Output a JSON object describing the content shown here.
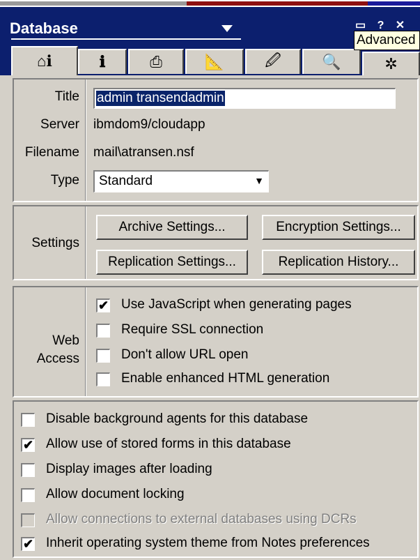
{
  "window": {
    "title": "Database",
    "tooltip": "Advanced",
    "control_icons": "▭ ? ✕"
  },
  "tabs": [
    {
      "name": "basics",
      "icon": "⌂ℹ",
      "active": true
    },
    {
      "name": "info",
      "icon": "ℹ"
    },
    {
      "name": "print",
      "icon": "⎙"
    },
    {
      "name": "design",
      "icon": "📐"
    },
    {
      "name": "launch",
      "icon": "🖉"
    },
    {
      "name": "full-text",
      "icon": "🔍"
    },
    {
      "name": "advanced",
      "icon": "✲"
    }
  ],
  "basics": {
    "title_label": "Title",
    "title_value": "admin transendadmin",
    "server_label": "Server",
    "server_value": "ibmdom9/cloudapp",
    "filename_label": "Filename",
    "filename_value": "mail\\atransen.nsf",
    "type_label": "Type",
    "type_value": "Standard"
  },
  "settings": {
    "label": "Settings",
    "archive": "Archive Settings...",
    "encryption": "Encryption Settings...",
    "replication": "Replication Settings...",
    "history": "Replication History..."
  },
  "web_access": {
    "label_line1": "Web",
    "label_line2": "Access",
    "items": [
      {
        "label": "Use JavaScript when generating pages",
        "checked": true
      },
      {
        "label": "Require SSL connection",
        "checked": false
      },
      {
        "label": "Don't allow URL open",
        "checked": false
      },
      {
        "label": "Enable enhanced HTML generation",
        "checked": false
      }
    ]
  },
  "options": [
    {
      "label": "Disable background agents for this database",
      "checked": false,
      "enabled": true
    },
    {
      "label": "Allow use of stored forms in this database",
      "checked": true,
      "enabled": true
    },
    {
      "label": "Display images after loading",
      "checked": false,
      "enabled": true
    },
    {
      "label": "Allow document locking",
      "checked": false,
      "enabled": true
    },
    {
      "label": "Allow connections to external databases using DCRs",
      "checked": false,
      "enabled": false
    },
    {
      "label": "Inherit operating system theme from Notes preferences",
      "checked": true,
      "enabled": true
    }
  ],
  "check_glyph": "✔",
  "select_arrow": "▼"
}
